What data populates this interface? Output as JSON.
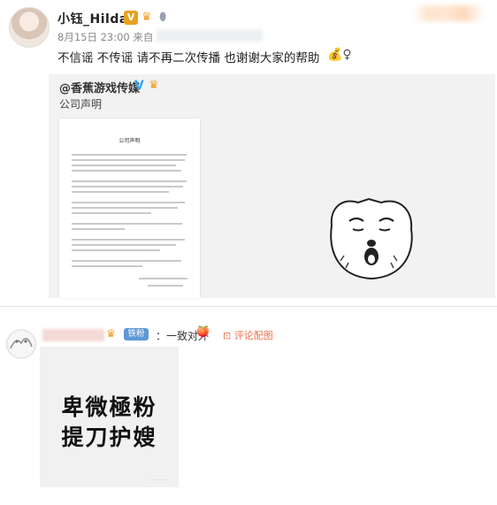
{
  "post": {
    "username": "小钰_Hilda",
    "verified_badge": "V",
    "timestamp": "8月15日 23:00 来自",
    "text": "不信谣 不传谣 请不再二次传播 也谢谢大家的帮助",
    "emoji_icons": [
      "money-bag-icon",
      "female-sign-icon"
    ]
  },
  "repost": {
    "account": "@香蕉游戏传媒",
    "verified_icon": "V",
    "caption": "公司声明",
    "document": {
      "title": "公司声明"
    }
  },
  "comment": {
    "fan_badge": "铁粉",
    "text": "：一致对外",
    "reply_link": "评论配图",
    "image_text_line1": "卑微極粉",
    "image_text_line2": "提刀护嫂"
  },
  "colors": {
    "accent_orange": "#eb7350",
    "verified_blue": "#2da7f2",
    "gold_badge": "#e8a021",
    "fan_badge_blue": "#5e98d6"
  }
}
